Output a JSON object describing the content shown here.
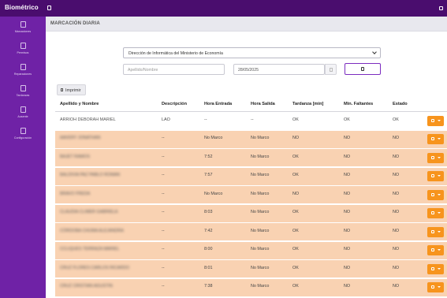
{
  "app": {
    "title": "Biométrico"
  },
  "sidebar": {
    "items": [
      {
        "label": "Marcaciones"
      },
      {
        "label": "Permisos"
      },
      {
        "label": "Reparaciones"
      },
      {
        "label": "Tardanzas"
      },
      {
        "label": "Ausente"
      },
      {
        "label": "Configuración"
      }
    ]
  },
  "page": {
    "title": "MARCACIÓN DIARIA"
  },
  "filters": {
    "office_selected": "Dirección de Informática del Ministerio de Economía",
    "lastname_placeholder": "Apellido/Nombre",
    "date_value": "28/05/2025"
  },
  "toolbar": {
    "print_label": "Imprimir"
  },
  "table": {
    "headers": {
      "name": "Apellido y Nombre",
      "desc": "Descripción",
      "in": "Hora Entrada",
      "out": "Hora Salida",
      "late": "Tardanza [min]",
      "missing": "Min. Faltantes",
      "status": "Estado"
    },
    "rows": [
      {
        "name": "ARRIOH DEBORAH MARIEL",
        "desc": "LAO",
        "in": "--",
        "out": "--",
        "late": "OK",
        "missing": "OK",
        "status": "OK",
        "highlight": false
      },
      {
        "name": "AAVERY JONATHAN",
        "desc": "--",
        "in": "No Marco",
        "out": "No Marco",
        "late": "NO",
        "missing": "NO",
        "status": "NO",
        "highlight": true
      },
      {
        "name": "BAJET RAMOS",
        "desc": "--",
        "in": "7:52",
        "out": "No Marco",
        "late": "OK",
        "missing": "NO",
        "status": "NO",
        "highlight": true
      },
      {
        "name": "BALDIVIA PAZ PABLO ROMAN",
        "desc": "--",
        "in": "7:57",
        "out": "No Marco",
        "late": "OK",
        "missing": "NO",
        "status": "NO",
        "highlight": true
      },
      {
        "name": "BRAVO FREDA",
        "desc": "--",
        "in": "No Marco",
        "out": "No Marco",
        "late": "NO",
        "missing": "NO",
        "status": "NO",
        "highlight": true
      },
      {
        "name": "CLAUDIA CLIMER GABRIELA",
        "desc": "--",
        "in": "8:03",
        "out": "No Marco",
        "late": "OK",
        "missing": "NO",
        "status": "NO",
        "highlight": true
      },
      {
        "name": "CÓRDOBA CHUMA ALEJANDRA",
        "desc": "--",
        "in": "7:42",
        "out": "No Marco",
        "late": "OK",
        "missing": "NO",
        "status": "NO",
        "highlight": true
      },
      {
        "name": "CCLIQUES TERRAZA MARIEL",
        "desc": "--",
        "in": "8:00",
        "out": "No Marco",
        "late": "OK",
        "missing": "NO",
        "status": "NO",
        "highlight": true
      },
      {
        "name": "CRUZ FLORES CARLOS RICARDO",
        "desc": "--",
        "in": "8:01",
        "out": "No Marco",
        "late": "OK",
        "missing": "NO",
        "status": "NO",
        "highlight": true
      },
      {
        "name": "CRUZ CRISTIAN AGUSTIN",
        "desc": "--",
        "in": "7:38",
        "out": "No Marco",
        "late": "OK",
        "missing": "NO",
        "status": "NO",
        "highlight": true
      }
    ]
  },
  "colors": {
    "topbar": "#4a0d6e",
    "sidebar": "#6f22a6",
    "row_highlight": "#f9d2b2",
    "action_button": "#f7941d",
    "search_border": "#7b2cbf"
  },
  "icons": {
    "brand_toggle": "square-toggle-icon",
    "top_right": "window-icon",
    "sidebar": "square-icon",
    "calendar": "calendar-icon",
    "search": "search-icon",
    "print": "print-icon",
    "action": "settings-icon"
  }
}
